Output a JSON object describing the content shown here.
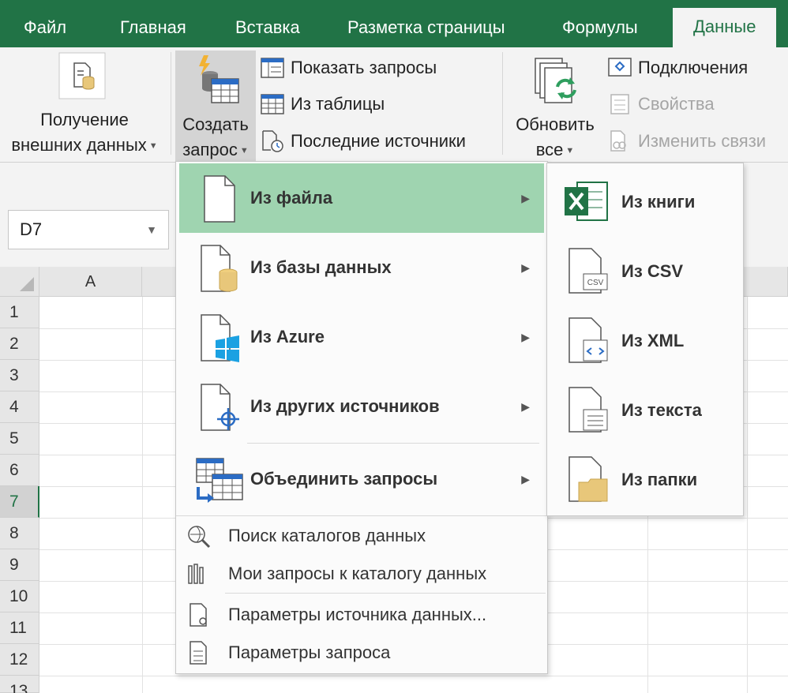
{
  "tabs": [
    {
      "label": "Файл"
    },
    {
      "label": "Главная"
    },
    {
      "label": "Вставка"
    },
    {
      "label": "Разметка страницы"
    },
    {
      "label": "Формулы"
    },
    {
      "label": "Данные"
    }
  ],
  "ribbon": {
    "get_external_line1": "Получение",
    "get_external_line2": "внешних данных",
    "create_query_line1": "Создать",
    "create_query_line2": "запрос",
    "show_queries": "Показать запросы",
    "from_table": "Из таблицы",
    "recent_sources": "Последние источники",
    "refresh_line1": "Обновить",
    "refresh_line2": "все",
    "connections": "Подключения",
    "properties": "Свойства",
    "edit_links": "Изменить связи"
  },
  "namebox": {
    "value": "D7"
  },
  "grid": {
    "column_a": "A",
    "rows": [
      "1",
      "2",
      "3",
      "4",
      "5",
      "6",
      "7",
      "8",
      "9",
      "10",
      "11",
      "12",
      "13"
    ],
    "selected_row": "7"
  },
  "menu": {
    "from_file": "Из файла",
    "from_database": "Из базы данных",
    "from_azure": "Из Azure",
    "from_other": "Из других источников",
    "combine_queries": "Объединить запросы",
    "search_catalogs": "Поиск каталогов данных",
    "my_catalog_queries": "Мои запросы к каталогу данных",
    "data_source_settings": "Параметры источника данных...",
    "query_options": "Параметры запроса"
  },
  "submenu": {
    "from_workbook": "Из книги",
    "from_csv": "Из CSV",
    "from_xml": "Из XML",
    "from_text": "Из текста",
    "from_folder": "Из папки"
  },
  "colors": {
    "excel_green": "#217346",
    "highlight": "#9fd4b0",
    "folder": "#e8c77a",
    "azure": "#1ba1e2"
  }
}
